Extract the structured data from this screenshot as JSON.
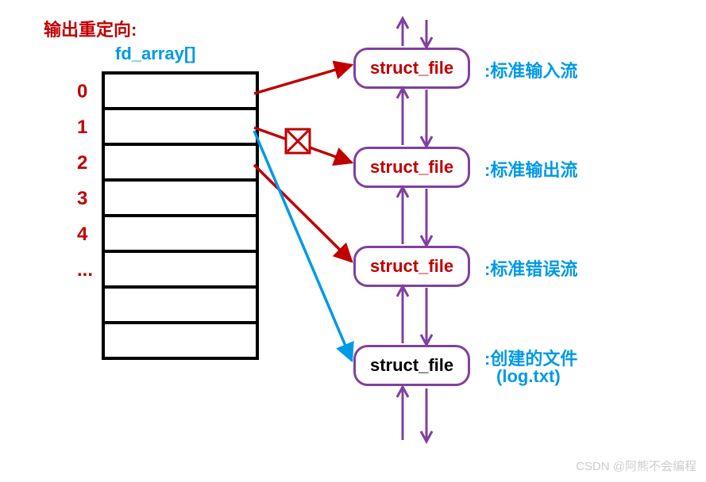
{
  "title": "输出重定向:",
  "array_label": "fd_array[]",
  "fd_indices": [
    "0",
    "1",
    "2",
    "3",
    "4",
    "..."
  ],
  "struct_nodes": [
    {
      "label": "struct_file",
      "desc": ":标准输入流"
    },
    {
      "label": "struct_file",
      "desc": ":标准输出流"
    },
    {
      "label": "struct_file",
      "desc": ":标准错误流"
    },
    {
      "label": "struct_file",
      "desc_line1": ":创建的文件",
      "desc_line2": "(log.txt)"
    }
  ],
  "watermark": "CSDN @阿熊不会编程",
  "colors": {
    "red": "#c00000",
    "blue": "#0099e5",
    "purple": "#8040a0"
  }
}
